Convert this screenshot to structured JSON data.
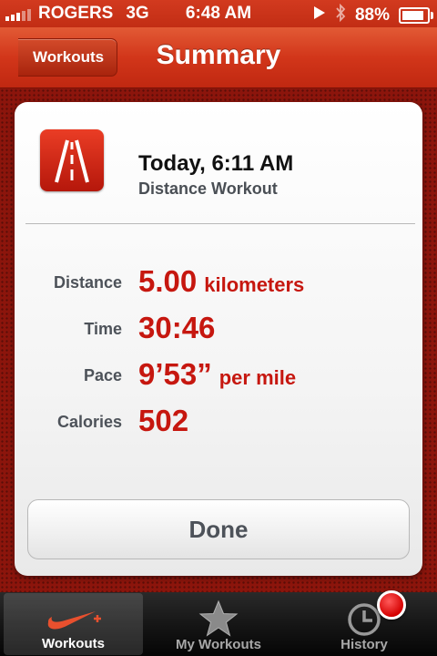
{
  "status_bar": {
    "carrier": "ROGERS",
    "network": "3G",
    "time": "6:48 AM",
    "battery": "88%",
    "battery_level": 0.88,
    "icons": [
      "signal-icon",
      "play-icon",
      "bluetooth-icon",
      "battery-icon"
    ]
  },
  "nav": {
    "back_label": "Workouts",
    "title": "Summary"
  },
  "summary": {
    "date_time": "Today, 6:11 AM",
    "workout_type": "Distance Workout",
    "icon": "road-icon"
  },
  "stats": [
    {
      "label": "Distance",
      "value": "5.00",
      "unit": "kilometers"
    },
    {
      "label": "Time",
      "value": "30:46",
      "unit": ""
    },
    {
      "label": "Pace",
      "value": "9’53”",
      "unit": "per mile"
    },
    {
      "label": "Calories",
      "value": "502",
      "unit": ""
    }
  ],
  "done_label": "Done",
  "tabs": [
    {
      "label": "Workouts",
      "icon": "nike-swoosh-icon",
      "active": true
    },
    {
      "label": "My Workouts",
      "icon": "star-icon",
      "active": false
    },
    {
      "label": "History",
      "icon": "clock-icon",
      "active": false
    }
  ],
  "colors": {
    "accent_red": "#c6170f",
    "nav_red": "#d2361a",
    "background_red": "#8c150c"
  }
}
